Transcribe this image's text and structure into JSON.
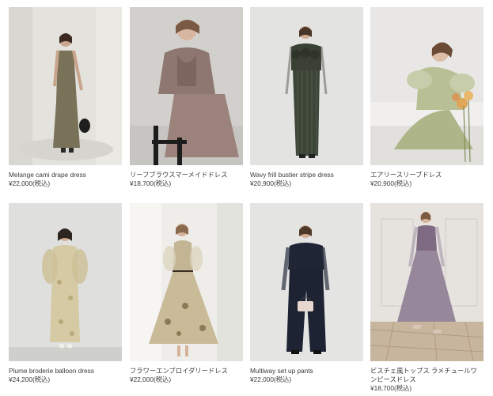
{
  "products": [
    {
      "name": "Melange cami drape dress",
      "price": "¥22,000(税込)"
    },
    {
      "name": "リーフブラウスマーメイドドレス",
      "price": "¥18,700(税込)"
    },
    {
      "name": "Wavy frill bustier stripe dress",
      "price": "¥20,900(税込)"
    },
    {
      "name": "エアリースリーブドレス",
      "price": "¥20,900(税込)"
    },
    {
      "name": "Plume broderie balloon dress",
      "price": "¥24,200(税込)"
    },
    {
      "name": "フラワーエンブロイダリードレス",
      "price": "¥22,000(税込)"
    },
    {
      "name": "Multiway set up pants",
      "price": "¥22,000(税込)"
    },
    {
      "name": "ビスチェ風トップス ラメチュールワンピースドレス",
      "price": "¥18,700(税込)"
    }
  ],
  "colors": {
    "text": "#3a3a3a",
    "background": "#ffffff"
  }
}
